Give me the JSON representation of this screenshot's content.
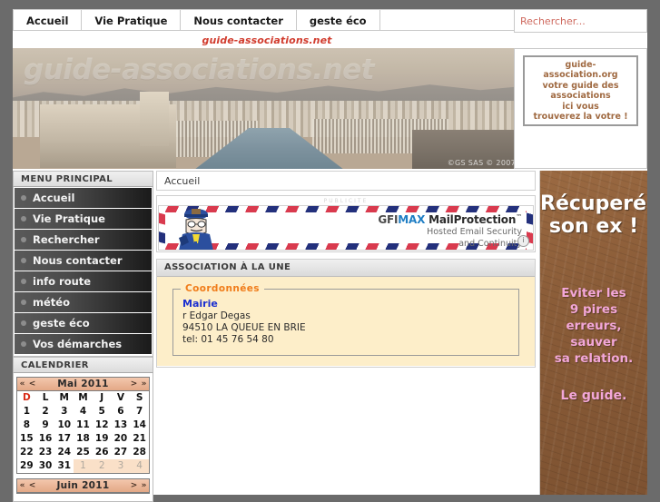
{
  "topnav": {
    "tabs": [
      {
        "label": "Accueil"
      },
      {
        "label": "Vie Pratique"
      },
      {
        "label": "Nous contacter"
      },
      {
        "label": "geste éco"
      }
    ]
  },
  "search": {
    "placeholder": "Rechercher...",
    "value": ""
  },
  "site": {
    "name": "guide-associations.net"
  },
  "banner": {
    "watermark": "guide-associations.net",
    "copyright": "©GS SAS © 2007"
  },
  "promo": {
    "lines": [
      "guide-",
      "association.org",
      "votre guide des",
      "associations",
      "ici vous",
      "trouverez la votre !"
    ]
  },
  "sidebar": {
    "menu_title": "MENU PRINCIPAL",
    "items": [
      {
        "label": "Accueil"
      },
      {
        "label": "Vie Pratique"
      },
      {
        "label": "Rechercher"
      },
      {
        "label": "Nous contacter"
      },
      {
        "label": "info route"
      },
      {
        "label": "météo"
      },
      {
        "label": "geste éco"
      },
      {
        "label": "Vos démarches"
      }
    ],
    "calendar_title": "CALENDRIER"
  },
  "calendar": {
    "prev_prev": "«",
    "prev": "<",
    "next": ">",
    "next_next": "»",
    "month1": "Mai 2011",
    "month2": "Juin 2011",
    "dow": [
      "D",
      "L",
      "M",
      "M",
      "J",
      "V",
      "S"
    ],
    "weeks": [
      [
        {
          "d": "1",
          "o": false
        },
        {
          "d": "2",
          "o": false
        },
        {
          "d": "3",
          "o": false
        },
        {
          "d": "4",
          "o": false
        },
        {
          "d": "5",
          "o": false
        },
        {
          "d": "6",
          "o": false
        },
        {
          "d": "7",
          "o": false
        }
      ],
      [
        {
          "d": "8",
          "o": false
        },
        {
          "d": "9",
          "o": false
        },
        {
          "d": "10",
          "o": false
        },
        {
          "d": "11",
          "o": false
        },
        {
          "d": "12",
          "o": false
        },
        {
          "d": "13",
          "o": false
        },
        {
          "d": "14",
          "o": false
        }
      ],
      [
        {
          "d": "15",
          "o": false
        },
        {
          "d": "16",
          "o": false
        },
        {
          "d": "17",
          "o": false
        },
        {
          "d": "18",
          "o": false
        },
        {
          "d": "19",
          "o": false
        },
        {
          "d": "20",
          "o": false
        },
        {
          "d": "21",
          "o": false
        }
      ],
      [
        {
          "d": "22",
          "o": false
        },
        {
          "d": "23",
          "o": false
        },
        {
          "d": "24",
          "o": false
        },
        {
          "d": "25",
          "o": false
        },
        {
          "d": "26",
          "o": false
        },
        {
          "d": "27",
          "o": false
        },
        {
          "d": "28",
          "o": false
        }
      ],
      [
        {
          "d": "29",
          "o": false
        },
        {
          "d": "30",
          "o": false
        },
        {
          "d": "31",
          "o": false
        },
        {
          "d": "1",
          "o": true
        },
        {
          "d": "2",
          "o": true
        },
        {
          "d": "3",
          "o": true
        },
        {
          "d": "4",
          "o": true
        }
      ]
    ]
  },
  "content": {
    "breadcrumb": "Accueil",
    "ad_label": "PUBLICITE",
    "ad": {
      "brand_gfi": "GFI",
      "brand_max": "MAX",
      "brand_product": "MailProtection",
      "brand_tm": "™",
      "sub_line1": "Hosted Email Security",
      "sub_line2": "and Continuity",
      "info_glyph": "i"
    },
    "featured_title": "ASSOCIATION À LA UNE",
    "fieldset_legend": "Coordonnées",
    "association": {
      "name": "Mairie",
      "street": "r Edgar Degas",
      "city": "94510 LA QUEUE EN BRIE",
      "phone": "tel: 01 45 76 54 80"
    }
  },
  "right_ad": {
    "title_line1": "Récuperér",
    "title_line2": "son ex !",
    "body_line1": "Eviter les",
    "body_line2": "9 pires",
    "body_line3": "erreurs,",
    "body_line4": "sauver",
    "body_line5": "sa relation.",
    "cta": "Le guide."
  },
  "colors": {
    "page_bg": "#6b6b6b",
    "accent_red": "#d13c2e",
    "calendar_header": "#e3a886",
    "featured_bg": "#fdeec9",
    "legend_orange": "#f07c1a",
    "assoc_name_blue": "#1b2fd0",
    "promo_brown": "#a06a42",
    "ad_pink": "#f3a7d8"
  }
}
